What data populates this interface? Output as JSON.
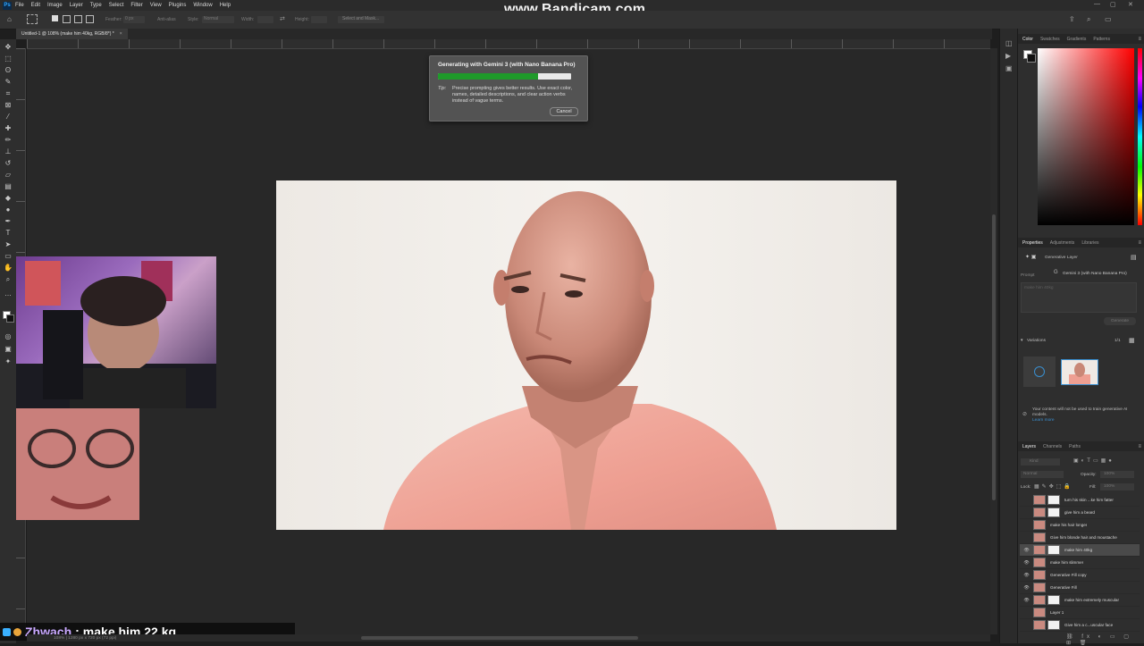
{
  "app": {
    "menu": [
      "File",
      "Edit",
      "Image",
      "Layer",
      "Type",
      "Select",
      "Filter",
      "View",
      "Plugins",
      "Window",
      "Help"
    ],
    "watermark": "www.Bandicam.com",
    "options": {
      "feather_label": "Feather:",
      "feather_value": "0 px",
      "antialias": "Anti-alias",
      "style_label": "Style:",
      "style_value": "Normal",
      "width_label": "Width:",
      "height_label": "Height:",
      "select_mask": "Select and Mask..."
    }
  },
  "document": {
    "tab_title": "Untitled-1 @ 108% (make him 40kg, RGB/8*) *",
    "close": "×",
    "status": "108% | 1280 px x 720 px (72 ppi)"
  },
  "dialog": {
    "title": "Generating with Gemini 3 (with Nano Banana Pro)",
    "progress": 0.75,
    "tip_label": "Tip:",
    "tip_text": "Precise prompting gives better results. Use exact color, names, detailed descriptions, and clear action verbs instead of vague terms.",
    "cancel": "Cancel"
  },
  "chat": {
    "user": "Zhwach",
    "separator": ":",
    "message": "make him 22 kg",
    "user_color": "#c9a8ff"
  },
  "panels": {
    "color_tabs": [
      "Color",
      "Swatches",
      "Gradients",
      "Patterns"
    ],
    "prop_tabs": [
      "Properties",
      "Adjustments",
      "Libraries"
    ],
    "gen_layer": "Generative Layer",
    "prompt_label": "Prompt",
    "model": "Gemini 3 (with Nano Banana Pro)",
    "prompt_placeholder": "make him 40kg",
    "generate": "Generate",
    "variations": "Variations",
    "variation_count": "1/1",
    "notice": "Your content will not be used to train generative AI models.",
    "learn_more": "Learn more",
    "layer_tabs": [
      "Layers",
      "Channels",
      "Paths"
    ],
    "kind_label": "Kind",
    "blend_mode": "Normal",
    "opacity_label": "Opacity:",
    "opacity_value": "100%",
    "lock_label": "Lock:",
    "fill_label": "Fill:",
    "fill_value": "100%",
    "layers": [
      {
        "name": "turn his skin ...ke him fatter",
        "visible": false,
        "mask": true,
        "active": false
      },
      {
        "name": "give him a beard",
        "visible": false,
        "mask": true,
        "active": false
      },
      {
        "name": "make his hair longer",
        "visible": false,
        "mask": false,
        "active": false
      },
      {
        "name": "Give him blonde hair and moustache",
        "visible": false,
        "mask": false,
        "active": false
      },
      {
        "name": "make him 40kg",
        "visible": true,
        "mask": true,
        "active": true
      },
      {
        "name": "make him slimmer",
        "visible": true,
        "mask": false,
        "active": false
      },
      {
        "name": "Generative Fill copy",
        "visible": true,
        "mask": false,
        "active": false
      },
      {
        "name": "Generative Fill",
        "visible": true,
        "mask": false,
        "active": false
      },
      {
        "name": "make him extremely muscular",
        "visible": true,
        "mask": true,
        "active": false
      },
      {
        "name": "Layer 1",
        "visible": false,
        "mask": false,
        "active": false
      },
      {
        "name": "Give him a c...uscular face",
        "visible": false,
        "mask": true,
        "active": false
      }
    ]
  }
}
